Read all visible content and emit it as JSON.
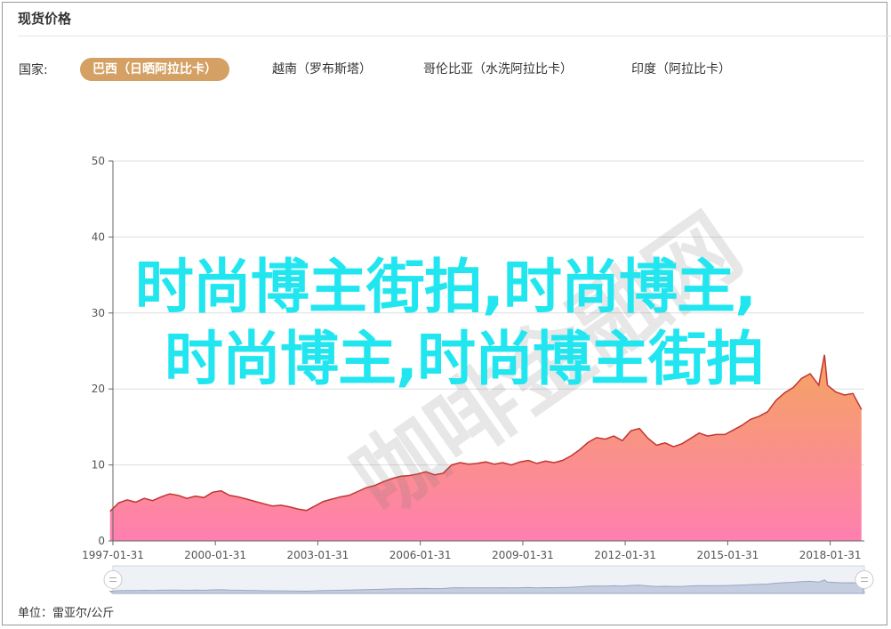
{
  "header": {
    "title": "现货价格"
  },
  "filter": {
    "label": "国家:",
    "options": [
      {
        "label": "巴西（日晒阿拉比卡）",
        "active": true
      },
      {
        "label": "越南（罗布斯塔）",
        "active": false
      },
      {
        "label": "哥伦比亚（水洗阿拉比卡）",
        "active": false
      },
      {
        "label": "印度（阿拉比卡）",
        "active": false
      }
    ]
  },
  "unit_label": "单位：雷亚尔/公斤",
  "overlay": {
    "line1": "时尚博主街拍,时尚博主,",
    "line2": "时尚博主,时尚博主街拍"
  },
  "watermark": "咖啡金融网",
  "colors": {
    "accent": "#d4a063",
    "line": "#c23531",
    "area_top": "#f4a460",
    "area_bottom": "#ff7fb0",
    "overlay": "#21e6f0"
  },
  "chart_data": {
    "type": "area",
    "title": "",
    "xlabel": "",
    "ylabel": "",
    "ylim": [
      0,
      50
    ],
    "yticks": [
      0,
      10,
      20,
      30,
      40,
      50
    ],
    "x_tick_labels": [
      "1997-01-31",
      "2000-01-31",
      "2003-01-31",
      "2006-01-31",
      "2009-01-31",
      "2012-01-31",
      "2015-01-31",
      "2018-01-31"
    ],
    "x_range": [
      "1997-01-31",
      "2019-01-31"
    ],
    "grid": true,
    "data_zoom": true,
    "series": [
      {
        "values": [
          [
            "1997-01",
            3.9
          ],
          [
            "1997-04",
            5.0
          ],
          [
            "1997-07",
            5.4
          ],
          [
            "1997-10",
            5.1
          ],
          [
            "1998-01",
            5.6
          ],
          [
            "1998-04",
            5.3
          ],
          [
            "1998-07",
            5.8
          ],
          [
            "1998-10",
            6.2
          ],
          [
            "1999-01",
            6.0
          ],
          [
            "1999-04",
            5.6
          ],
          [
            "1999-07",
            5.9
          ],
          [
            "1999-10",
            5.7
          ],
          [
            "2000-01",
            6.4
          ],
          [
            "2000-04",
            6.6
          ],
          [
            "2000-07",
            6.0
          ],
          [
            "2000-10",
            5.8
          ],
          [
            "2001-01",
            5.5
          ],
          [
            "2001-04",
            5.2
          ],
          [
            "2001-07",
            4.9
          ],
          [
            "2001-10",
            4.6
          ],
          [
            "2002-01",
            4.7
          ],
          [
            "2002-04",
            4.5
          ],
          [
            "2002-07",
            4.2
          ],
          [
            "2002-10",
            4.0
          ],
          [
            "2003-01",
            4.6
          ],
          [
            "2003-04",
            5.2
          ],
          [
            "2003-07",
            5.5
          ],
          [
            "2003-10",
            5.8
          ],
          [
            "2004-01",
            6.0
          ],
          [
            "2004-04",
            6.5
          ],
          [
            "2004-07",
            7.0
          ],
          [
            "2004-10",
            7.3
          ],
          [
            "2005-01",
            7.8
          ],
          [
            "2005-04",
            8.2
          ],
          [
            "2005-07",
            8.5
          ],
          [
            "2005-10",
            8.6
          ],
          [
            "2006-01",
            8.8
          ],
          [
            "2006-04",
            9.1
          ],
          [
            "2006-07",
            8.7
          ],
          [
            "2006-10",
            8.9
          ],
          [
            "2007-01",
            10.0
          ],
          [
            "2007-04",
            10.3
          ],
          [
            "2007-07",
            10.1
          ],
          [
            "2007-10",
            10.2
          ],
          [
            "2008-01",
            10.4
          ],
          [
            "2008-04",
            10.1
          ],
          [
            "2008-07",
            10.3
          ],
          [
            "2008-10",
            10.0
          ],
          [
            "2009-01",
            10.4
          ],
          [
            "2009-04",
            10.6
          ],
          [
            "2009-07",
            10.2
          ],
          [
            "2009-10",
            10.5
          ],
          [
            "2010-01",
            10.3
          ],
          [
            "2010-04",
            10.6
          ],
          [
            "2010-07",
            11.2
          ],
          [
            "2010-10",
            12.0
          ],
          [
            "2011-01",
            13.0
          ],
          [
            "2011-04",
            13.6
          ],
          [
            "2011-07",
            13.4
          ],
          [
            "2011-10",
            13.8
          ],
          [
            "2012-01",
            13.2
          ],
          [
            "2012-04",
            14.5
          ],
          [
            "2012-07",
            14.8
          ],
          [
            "2012-10",
            13.5
          ],
          [
            "2013-01",
            12.6
          ],
          [
            "2013-04",
            12.9
          ],
          [
            "2013-07",
            12.4
          ],
          [
            "2013-10",
            12.8
          ],
          [
            "2014-01",
            13.5
          ],
          [
            "2014-04",
            14.2
          ],
          [
            "2014-07",
            13.8
          ],
          [
            "2014-10",
            14.0
          ],
          [
            "2015-01",
            14.0
          ],
          [
            "2015-04",
            14.6
          ],
          [
            "2015-07",
            15.2
          ],
          [
            "2015-10",
            16.0
          ],
          [
            "2016-01",
            16.4
          ],
          [
            "2016-04",
            17.0
          ],
          [
            "2016-07",
            18.5
          ],
          [
            "2016-10",
            19.5
          ],
          [
            "2017-01",
            20.2
          ],
          [
            "2017-04",
            21.4
          ],
          [
            "2017-07",
            22.0
          ],
          [
            "2017-10",
            20.5
          ],
          [
            "2017-12",
            24.5
          ],
          [
            "2018-01",
            20.5
          ],
          [
            "2018-04",
            19.6
          ],
          [
            "2018-07",
            19.2
          ],
          [
            "2018-10",
            19.4
          ],
          [
            "2019-01",
            17.3
          ]
        ]
      }
    ]
  }
}
